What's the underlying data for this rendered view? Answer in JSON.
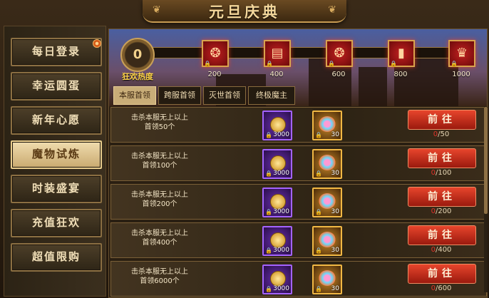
{
  "title": "元旦庆典",
  "sidebar": {
    "items": [
      {
        "label": "每日登录",
        "active": false,
        "badge": true
      },
      {
        "label": "幸运圆蛋",
        "active": false,
        "badge": false
      },
      {
        "label": "新年心愿",
        "active": false,
        "badge": false
      },
      {
        "label": "魔物试炼",
        "active": true,
        "badge": false
      },
      {
        "label": "时装盛宴",
        "active": false,
        "badge": false
      },
      {
        "label": "充值狂欢",
        "active": false,
        "badge": false
      },
      {
        "label": "超值限购",
        "active": false,
        "badge": false
      }
    ]
  },
  "heat": {
    "value": "0",
    "label": "狂欢热度",
    "milestones": [
      "200",
      "400",
      "600",
      "800",
      "1000"
    ],
    "progress_fraction": 0
  },
  "tabs": [
    {
      "label": "本服首领",
      "active": true
    },
    {
      "label": "跨服首领",
      "active": false
    },
    {
      "label": "灭世首领",
      "active": false
    },
    {
      "label": "终极魔主",
      "active": false
    }
  ],
  "tasks": [
    {
      "desc_line1": "击杀本服无上以上",
      "desc_line2": "首领50个",
      "reward1_qty": "3000",
      "reward2_qty": "30",
      "button": "前往",
      "current": "0",
      "target": "50"
    },
    {
      "desc_line1": "击杀本服无上以上",
      "desc_line2": "首领100个",
      "reward1_qty": "3000",
      "reward2_qty": "30",
      "button": "前往",
      "current": "0",
      "target": "100"
    },
    {
      "desc_line1": "击杀本服无上以上",
      "desc_line2": "首领200个",
      "reward1_qty": "3000",
      "reward2_qty": "30",
      "button": "前往",
      "current": "0",
      "target": "200"
    },
    {
      "desc_line1": "击杀本服无上以上",
      "desc_line2": "首领400个",
      "reward1_qty": "3000",
      "reward2_qty": "30",
      "button": "前往",
      "current": "0",
      "target": "400"
    },
    {
      "desc_line1": "击杀本服无上以上",
      "desc_line2": "首领6000个",
      "reward1_qty": "3000",
      "reward2_qty": "30",
      "button": "前往",
      "current": "0",
      "target": "600"
    }
  ],
  "icons": {
    "reward1": "gold-coin-icon",
    "reward2": "fireworks-icon",
    "lock": "lock-icon"
  },
  "colors": {
    "accent_gold": "#d9a34d",
    "button_red": "#e7452c",
    "progress_current": "#e0342a"
  }
}
